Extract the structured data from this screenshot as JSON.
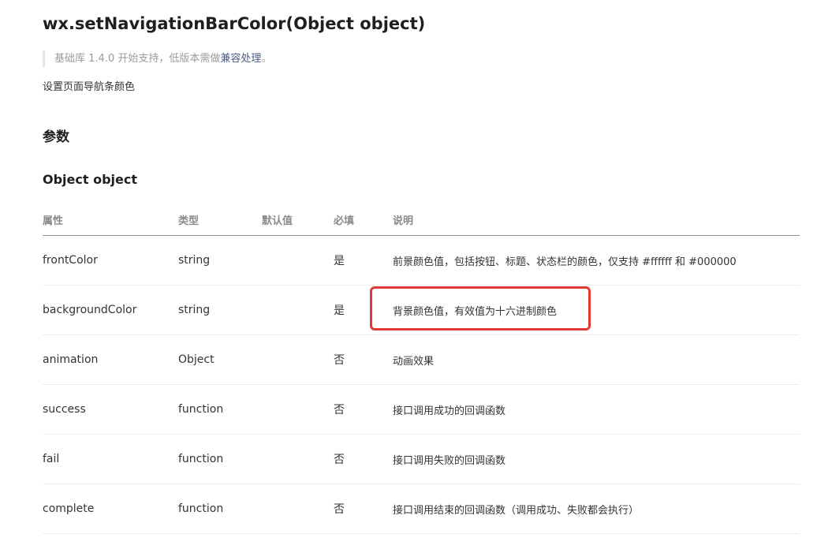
{
  "header": {
    "title": "wx.setNavigationBarColor(Object object)",
    "version_prefix": "基础库 1.4.0 开始支持，低版本需做",
    "version_link": "兼容处理",
    "version_suffix": "。",
    "description": "设置页面导航条颜色"
  },
  "params_section": {
    "heading": "参数",
    "subheading": "Object object",
    "columns": {
      "name": "属性",
      "type": "类型",
      "default": "默认值",
      "required": "必填",
      "desc": "说明"
    },
    "rows": [
      {
        "name": "frontColor",
        "type": "string",
        "default": "",
        "required": "是",
        "desc": "前景颜色值，包括按钮、标题、状态栏的颜色，仅支持 #ffffff 和 #000000"
      },
      {
        "name": "backgroundColor",
        "type": "string",
        "default": "",
        "required": "是",
        "desc": "背景颜色值，有效值为十六进制颜色"
      },
      {
        "name": "animation",
        "type": "Object",
        "default": "",
        "required": "否",
        "desc": "动画效果"
      },
      {
        "name": "success",
        "type": "function",
        "default": "",
        "required": "否",
        "desc": "接口调用成功的回调函数"
      },
      {
        "name": "fail",
        "type": "function",
        "default": "",
        "required": "否",
        "desc": "接口调用失败的回调函数"
      },
      {
        "name": "complete",
        "type": "function",
        "default": "",
        "required": "否",
        "desc": "接口调用结束的回调函数（调用成功、失败都会执行）"
      }
    ]
  },
  "colors": {
    "highlight_border": "#e53935",
    "link": "#4a5b85",
    "note_text": "#9a9a9a"
  }
}
